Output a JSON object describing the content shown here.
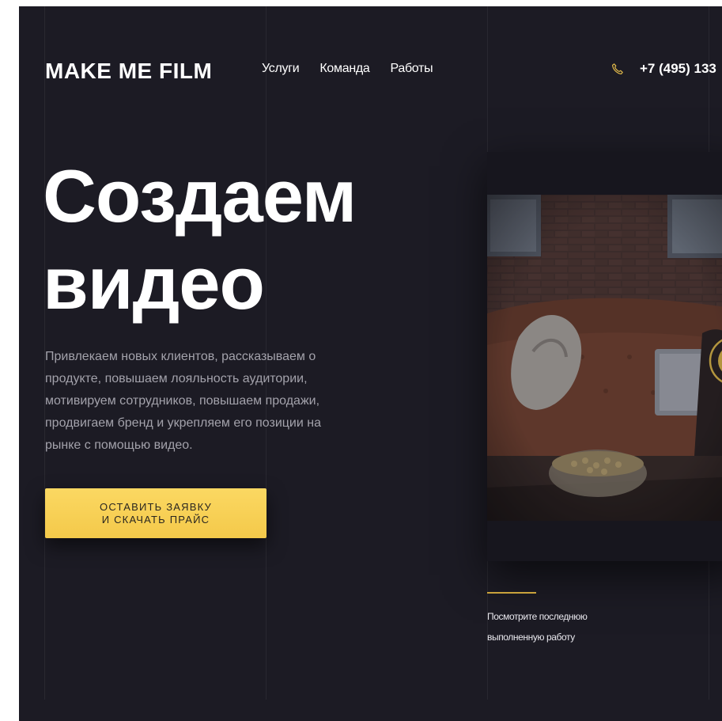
{
  "header": {
    "logo": "MAKE ME FILM",
    "nav": [
      {
        "label": "Услуги"
      },
      {
        "label": "Команда"
      },
      {
        "label": "Работы"
      }
    ],
    "phone": {
      "icon": "phone-icon",
      "number": "+7 (495) 133"
    }
  },
  "hero": {
    "title_line1": "Создаем",
    "title_line2": "видео",
    "description": "Привлекаем новых клиентов, рассказываем о продукте, повышаем лояльность аудитории, мотивируем сотрудников, повышаем продажи, продвигаем бренд и укрепляем его позиции на рынке с помощью видео.",
    "cta_line1": "ОСТАВИТЬ ЗАЯВКУ",
    "cta_line2": "И СКАЧАТЬ ПРАЙС"
  },
  "video": {
    "play_icon": "play-icon",
    "caption_line1": "Посмотрите последнюю",
    "caption_line2": "выполненную работу"
  },
  "colors": {
    "background": "#1c1b24",
    "accent": "#f7cf55",
    "text": "#ffffff",
    "muted_text": "#a3a2ab"
  }
}
